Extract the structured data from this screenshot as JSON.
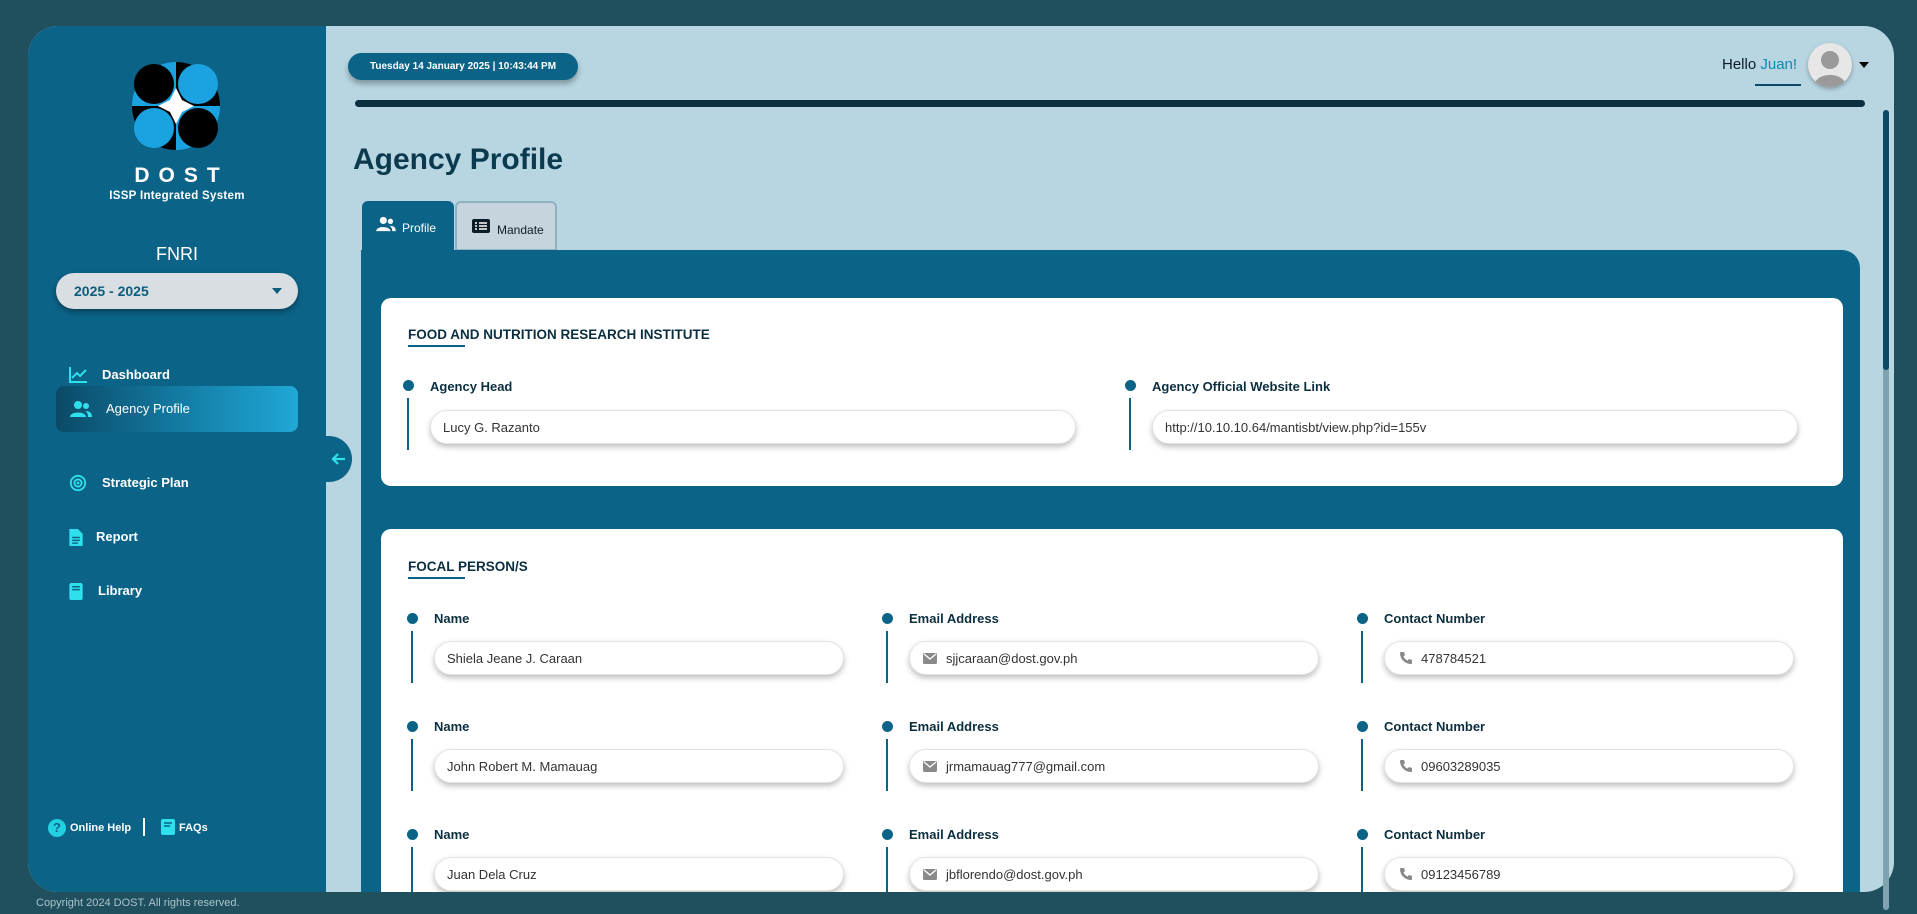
{
  "sidebar": {
    "brand": "DOST",
    "brand_sub": "ISSP Integrated System",
    "agency_code": "FNRI",
    "year_select": "2025 - 2025",
    "nav": [
      {
        "label": "Dashboard",
        "icon": "chart-line-icon"
      },
      {
        "label": "Agency Profile",
        "icon": "users-icon",
        "active": true
      },
      {
        "label": "Strategic Plan",
        "icon": "target-icon"
      },
      {
        "label": "Report",
        "icon": "document-icon"
      },
      {
        "label": "Library",
        "icon": "book-icon"
      }
    ],
    "help": {
      "online_help": "Online Help",
      "faqs": "FAQs"
    }
  },
  "footer": {
    "copyright": "Copyright 2024 DOST. All rights reserved."
  },
  "header": {
    "datetime": "Tuesday 14 January 2025 | 10:43:44 PM",
    "greeting": "Hello ",
    "user_name": "Juan!"
  },
  "main": {
    "title": "Agency Profile",
    "tabs": [
      {
        "label": "Profile",
        "active": true
      },
      {
        "label": "Mandate",
        "active": false
      }
    ],
    "agency_card": {
      "title": "FOOD AND NUTRITION RESEARCH INSTITUTE",
      "head_label": "Agency Head",
      "head_value": "Lucy G. Razanto",
      "website_label": "Agency Official Website Link",
      "website_value": "http://10.10.10.64/mantisbt/view.php?id=155v"
    },
    "focal_card": {
      "title": "FOCAL PERSON/S",
      "name_label": "Name",
      "email_label": "Email Address",
      "contact_label": "Contact Number",
      "persons": [
        {
          "name": "Shiela Jeane J. Caraan",
          "email": "sjjcaraan@dost.gov.ph",
          "contact": "478784521"
        },
        {
          "name": "John Robert M. Mamauag",
          "email": "jrmamauag777@gmail.com",
          "contact": "09603289035"
        },
        {
          "name": "Juan Dela Cruz",
          "email": "jbflorendo@dost.gov.ph",
          "contact": "09123456789"
        }
      ]
    }
  },
  "colors": {
    "primary": "#0b6388",
    "background": "#b8d6e2",
    "accent": "#22d0e0"
  }
}
